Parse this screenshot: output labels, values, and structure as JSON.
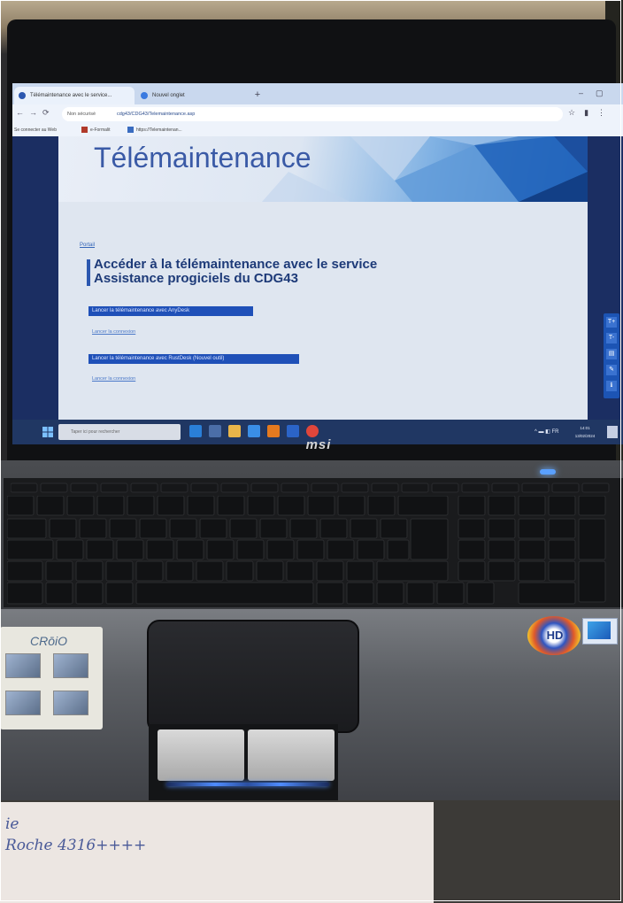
{
  "browser": {
    "tabs": [
      {
        "label": "Télémaintenance avec le service..."
      },
      {
        "label": "Nouvel onglet"
      }
    ],
    "security_label": "Non sécurisé",
    "url": "cdg43/CDG43/Telemaintenance.asp",
    "bookmarks": [
      "Se connecter au Web",
      "e-Formalit",
      "https://Telemaintenan..."
    ]
  },
  "page": {
    "banner_title": "Télémaintenance",
    "breadcrumb": "Portail",
    "heading_line1": "Accéder à la télémaintenance avec le service",
    "heading_line2": "Assistance progiciels du CDG43",
    "button_anydesk": "Lancer la télémaintenance avec AnyDesk",
    "link_anydesk": "Lancer la connexion",
    "button_rustdesk": "Lancer la télémaintenance avec RustDesk (Nouvel outil)",
    "link_rustdesk": "Lancer la connexion"
  },
  "side_toolbar": [
    "T+",
    "T-",
    "▤",
    "✎",
    "ℹ"
  ],
  "taskbar": {
    "search_placeholder": "Taper ici pour rechercher",
    "time": "14:01",
    "date": "13/02/2024",
    "tray_lang": "FR"
  },
  "laptop": {
    "brand": "msi",
    "cpu_sticker": "CRōiO",
    "hd_sticker": "HD"
  },
  "note": {
    "line1": "ie",
    "line2": "Roche 4316++++"
  },
  "colors": {
    "page_bg": "#dfe6f0",
    "banner_blue": "#1f5fb5",
    "button_blue": "#1f50b8",
    "taskbar": "#203763"
  }
}
